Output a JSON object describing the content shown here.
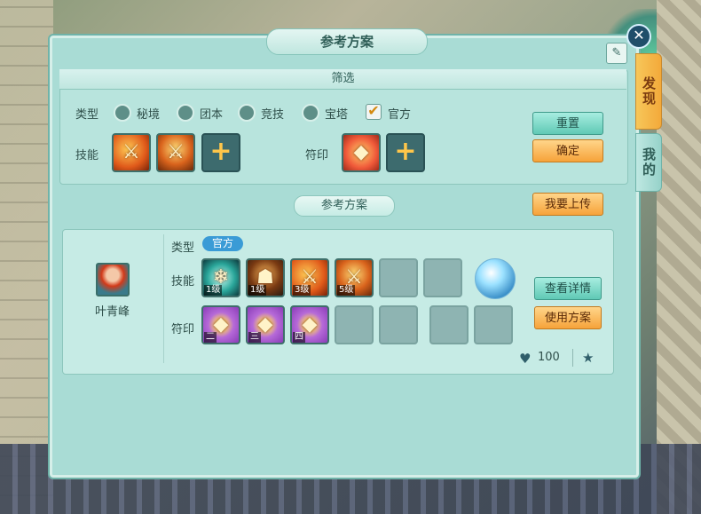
{
  "window": {
    "title": "参考方案",
    "close_symbol": "✕",
    "edit_symbol": "✎"
  },
  "side_tabs": [
    {
      "label": "发现"
    },
    {
      "label": "我的"
    }
  ],
  "filter": {
    "header": "筛选",
    "type_label": "类型",
    "types": [
      {
        "label": "秘境",
        "checked": false
      },
      {
        "label": "团本",
        "checked": false
      },
      {
        "label": "竞技",
        "checked": false
      },
      {
        "label": "宝塔",
        "checked": false
      },
      {
        "label": "官方",
        "checked": true
      }
    ],
    "skill_label": "技能",
    "rune_label": "符印",
    "add_symbol": "+",
    "reset_button": "重置",
    "confirm_button": "确定"
  },
  "upload_button": "我要上传",
  "section_title": "参考方案",
  "plan": {
    "character_name": "叶青峰",
    "type_label": "类型",
    "type_tag": "官方",
    "skill_label": "技能",
    "rune_label": "符印",
    "skills": [
      {
        "level": "1级",
        "icon": "skill-ice-icon"
      },
      {
        "level": "1级",
        "icon": "skill-warrior-icon"
      },
      {
        "level": "3级",
        "icon": "skill-flame-icon"
      },
      {
        "level": "5级",
        "icon": "skill-flame-icon"
      }
    ],
    "runes": [
      {
        "label": "二",
        "icon": "rune-gold-icon"
      },
      {
        "label": "三",
        "icon": "rune-gold-icon"
      },
      {
        "label": "四",
        "icon": "rune-gold-icon"
      }
    ],
    "details_button": "查看详情",
    "use_button": "使用方案",
    "likes": "100",
    "heart_symbol": "♥",
    "star_symbol": "★"
  },
  "colors": {
    "accent_orange": "#f6a33a",
    "accent_teal": "#5fc9b5",
    "panel": "#a9dcd5"
  }
}
